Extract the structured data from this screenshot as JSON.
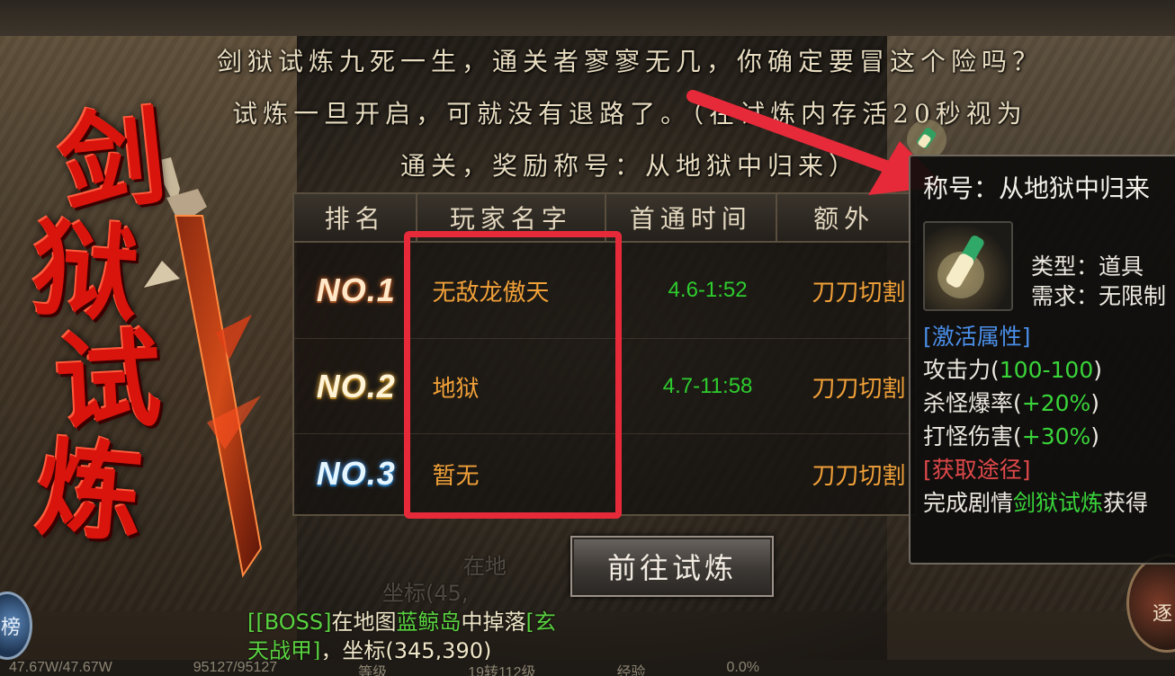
{
  "intro": {
    "line1": "剑狱试炼九死一生，通关者寥寥无几，你确定要冒这个险吗？",
    "line2": "试炼一旦开启，可就没有退路了。（在试炼内存活20秒视为",
    "line3": "通关，奖励称号：从地狱中归来）"
  },
  "title_chars": [
    "剑",
    "狱",
    "试",
    "炼"
  ],
  "table": {
    "headers": [
      "排名",
      "玩家名字",
      "首通时间",
      "额外"
    ],
    "rows": [
      {
        "rank": "NO.1",
        "name": "无敌龙傲天",
        "time": "4.6-1:52",
        "extra": "刀刀切割"
      },
      {
        "rank": "NO.2",
        "name": "地狱",
        "time": "4.7-11:58",
        "extra": "刀刀切割"
      },
      {
        "rank": "NO.3",
        "name": "暂无",
        "time": "",
        "extra": "刀刀切割"
      }
    ]
  },
  "button": {
    "label": "前往试炼"
  },
  "chat": {
    "ghost1": "在地",
    "ghost2": "坐标(45,",
    "line1_prefix": "[",
    "line1_boss": "[BOSS]",
    "line1_mid": "在地图",
    "line1_map": "蓝鲸岛",
    "line1_suffix": "中掉落",
    "line1_item": "[玄",
    "line2_item": "天战甲]",
    "line2_coord": "，坐标(345,390)"
  },
  "bottom_bar": [
    "47.67W/47.67W",
    "95127/95127",
    "等级",
    "19转112级",
    "经验",
    "0.0%"
  ],
  "side_buttons": {
    "left": "榜",
    "right": "逐"
  },
  "tooltip": {
    "title": "称号：从地狱中归来",
    "type_label": "类型：道具",
    "req_label": "需求：无限制",
    "section_attr": "[激活属性]",
    "atk_prefix": "攻击力(",
    "atk_value": "100-100",
    "atk_suffix": ")",
    "drop_prefix": "杀怪爆率(",
    "drop_value": "+20%",
    "drop_suffix": ")",
    "dmg_prefix": "打怪伤害(",
    "dmg_value": "+30%",
    "dmg_suffix": ")",
    "section_source": "[获取途径]",
    "source_prefix": "完成剧情",
    "source_quest": "剑狱试炼",
    "source_suffix": "获得"
  },
  "colors": {
    "highlight": "#e62a3a",
    "arrow": "#e62a3a",
    "player_name": "#f0a038",
    "time": "#2ecc2e",
    "title_red": "#d8140c"
  }
}
